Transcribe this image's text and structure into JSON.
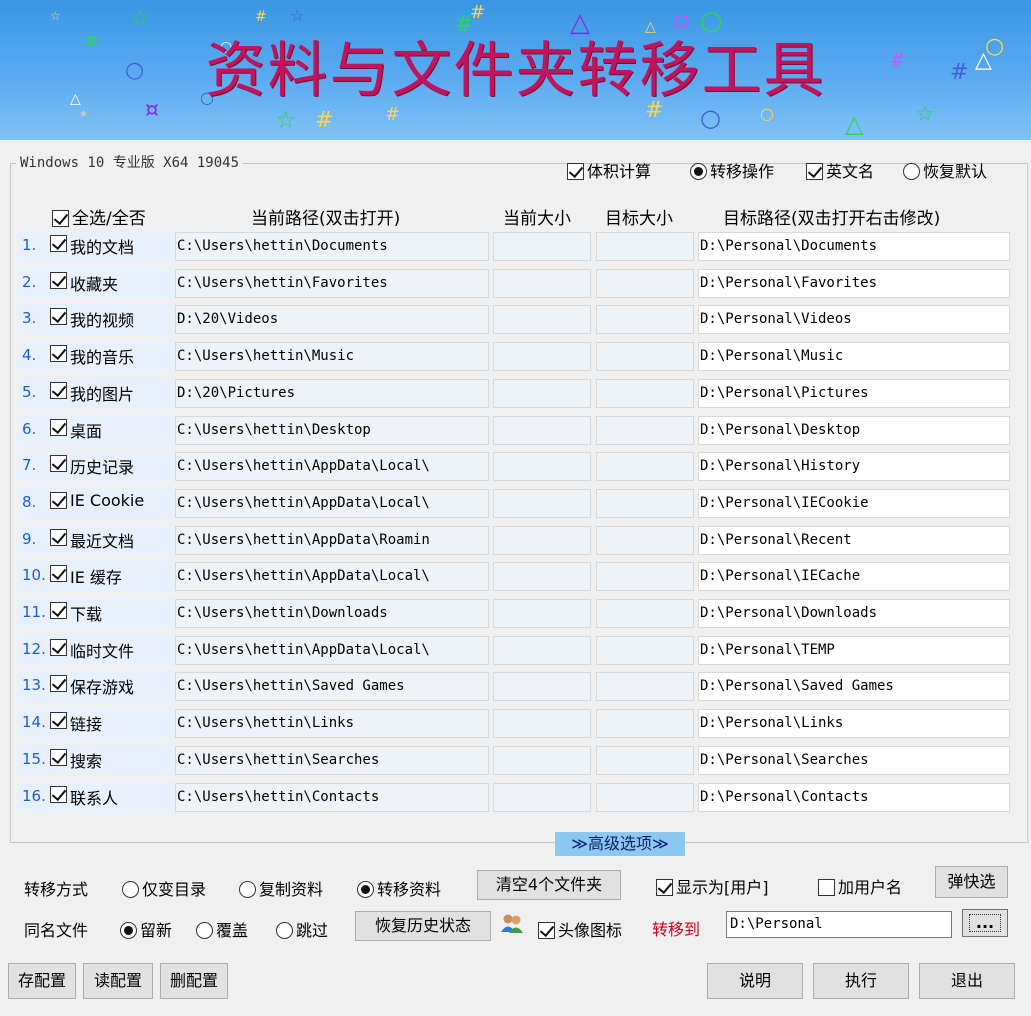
{
  "banner": {
    "title": "资料与文件夹转移工具"
  },
  "os_info": "Windows 10 专业版  X64 19045",
  "top_options": [
    {
      "type": "check",
      "checked": true,
      "label": "体积计算"
    },
    {
      "type": "radio",
      "checked": true,
      "label": "转移操作"
    },
    {
      "type": "check",
      "checked": true,
      "label": "英文名"
    },
    {
      "type": "radio",
      "checked": false,
      "label": "恢复默认"
    }
  ],
  "headers": {
    "select_all": "全选/全否",
    "current_path": "当前路径(双击打开)",
    "current_size": "当前大小",
    "target_size": "目标大小",
    "target_path": "目标路径(双击打开右击修改)"
  },
  "rows": [
    {
      "idx": "1.",
      "name": "我的文档",
      "current": "C:\\Users\\hettin\\Documents",
      "target": "D:\\Personal\\Documents"
    },
    {
      "idx": "2.",
      "name": "收藏夹",
      "current": "C:\\Users\\hettin\\Favorites",
      "target": "D:\\Personal\\Favorites"
    },
    {
      "idx": "3.",
      "name": "我的视频",
      "current": "D:\\20\\Videos",
      "target": "D:\\Personal\\Videos"
    },
    {
      "idx": "4.",
      "name": "我的音乐",
      "current": "C:\\Users\\hettin\\Music",
      "target": "D:\\Personal\\Music"
    },
    {
      "idx": "5.",
      "name": "我的图片",
      "current": "D:\\20\\Pictures",
      "target": "D:\\Personal\\Pictures"
    },
    {
      "idx": "6.",
      "name": "桌面",
      "current": "C:\\Users\\hettin\\Desktop",
      "target": "D:\\Personal\\Desktop"
    },
    {
      "idx": "7.",
      "name": "历史记录",
      "current": "C:\\Users\\hettin\\AppData\\Local\\",
      "target": "D:\\Personal\\History"
    },
    {
      "idx": "8.",
      "name": "IE Cookie",
      "current": "C:\\Users\\hettin\\AppData\\Local\\",
      "target": "D:\\Personal\\IECookie"
    },
    {
      "idx": "9.",
      "name": "最近文档",
      "current": "C:\\Users\\hettin\\AppData\\Roamin",
      "target": "D:\\Personal\\Recent"
    },
    {
      "idx": "10.",
      "name": "IE 缓存",
      "current": "C:\\Users\\hettin\\AppData\\Local\\",
      "target": "D:\\Personal\\IECache"
    },
    {
      "idx": "11.",
      "name": "下载",
      "current": "C:\\Users\\hettin\\Downloads",
      "target": "D:\\Personal\\Downloads"
    },
    {
      "idx": "12.",
      "name": "临时文件",
      "current": "C:\\Users\\hettin\\AppData\\Local\\",
      "target": "D:\\Personal\\TEMP"
    },
    {
      "idx": "13.",
      "name": "保存游戏",
      "current": "C:\\Users\\hettin\\Saved Games",
      "target": "D:\\Personal\\Saved Games"
    },
    {
      "idx": "14.",
      "name": "链接",
      "current": "C:\\Users\\hettin\\Links",
      "target": "D:\\Personal\\Links"
    },
    {
      "idx": "15.",
      "name": "搜索",
      "current": "C:\\Users\\hettin\\Searches",
      "target": "D:\\Personal\\Searches"
    },
    {
      "idx": "16.",
      "name": "联系人",
      "current": "C:\\Users\\hettin\\Contacts",
      "target": "D:\\Personal\\Contacts"
    }
  ],
  "advanced_toggle": "≫高级选项≫",
  "transfer_method": {
    "label": "转移方式",
    "options": [
      {
        "label": "仅变目录",
        "checked": false
      },
      {
        "label": "复制资料",
        "checked": false
      },
      {
        "label": "转移资料",
        "checked": true
      }
    ],
    "clear_button": "清空4个文件夹",
    "show_user": {
      "label": "显示为[用户]",
      "checked": true
    },
    "add_username": {
      "label": "加用户名",
      "checked": false
    },
    "quick_select_button": "弹快选"
  },
  "same_name": {
    "label": "同名文件",
    "options": [
      {
        "label": "留新",
        "checked": true
      },
      {
        "label": "覆盖",
        "checked": false
      },
      {
        "label": "跳过",
        "checked": false
      }
    ],
    "restore_button": "恢复历史状态",
    "avatar_icon": {
      "label": "头像图标",
      "checked": true
    },
    "move_to_label": "转移到",
    "move_to_value": "D:\\Personal",
    "browse_button": "..."
  },
  "bottom_buttons": {
    "save_config": "存配置",
    "load_config": "读配置",
    "delete_config": "删配置",
    "help": "说明",
    "execute": "执行",
    "exit": "退出"
  },
  "colors": {
    "banner": "#4aa0ea",
    "title": "#c2145c",
    "row_index": "#1a5fd0",
    "advanced_bg": "#8cc8f0",
    "move_to": "#d0021b"
  }
}
